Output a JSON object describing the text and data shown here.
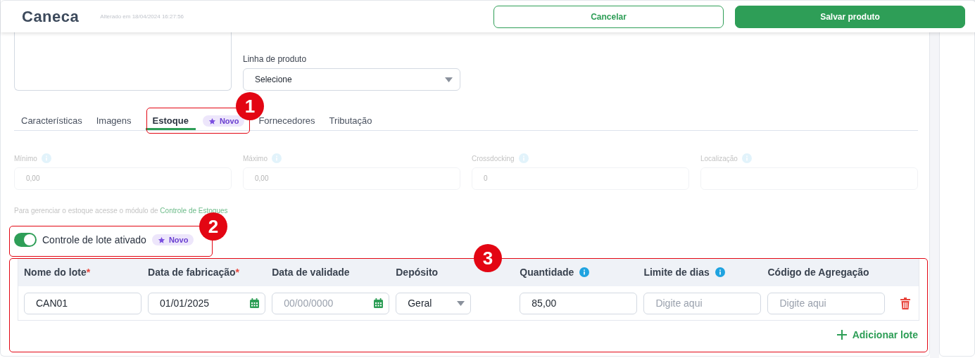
{
  "header": {
    "title": "Caneca",
    "subtitle": "Alterado em 18/04/2024 16:27:56",
    "buttons": [
      {
        "label": "Cancelar",
        "kind": "secondary"
      },
      {
        "label": "Salvar produto",
        "kind": "primary"
      }
    ]
  },
  "product_line": {
    "label": "Linha de produto",
    "value": "Selecione"
  },
  "tabs": [
    {
      "label": "Características",
      "selected": false
    },
    {
      "label": "Imagens",
      "selected": false
    },
    {
      "label": "Estoque",
      "selected": true,
      "badge": "Novo"
    },
    {
      "label": "Fornecedores",
      "selected": false
    },
    {
      "label": "Tributação",
      "selected": false
    }
  ],
  "stock_fields": [
    {
      "label": "Mínimo",
      "value": "0,00"
    },
    {
      "label": "Máximo",
      "value": "0,00"
    },
    {
      "label": "Crossdocking",
      "value": "0"
    },
    {
      "label": "Localização"
    }
  ],
  "stock_hint": {
    "text": "Para gerenciar o estoque acesse o módulo de",
    "link": "Controle de Estoques"
  },
  "batch_control": {
    "label": "Controle de lote ativado",
    "on": true,
    "badge": "Novo"
  },
  "batch_table": {
    "columns": [
      {
        "label": "Nome do lote",
        "required_mark": "*"
      },
      {
        "label": "Data de fabricação",
        "required_mark": "*"
      },
      {
        "label": "Data de validade"
      },
      {
        "label": "Depósito"
      },
      {
        "label": "Quantidade",
        "info": true
      },
      {
        "label": "Limite de dias",
        "info": true
      },
      {
        "label": "Código de Agregação"
      }
    ],
    "rows": [
      {
        "cells": [
          {
            "kind": "text",
            "value": "CAN01"
          },
          {
            "kind": "date",
            "value": "01/01/2025"
          },
          {
            "kind": "date",
            "placeholder": "00/00/0000"
          },
          {
            "kind": "select",
            "value": "Geral"
          },
          {
            "kind": "text",
            "value": "85,00"
          },
          {
            "kind": "text",
            "placeholder": "Digite aqui"
          },
          {
            "kind": "text",
            "placeholder": "Digite aqui"
          }
        ]
      }
    ],
    "add_label": "Adicionar lote"
  },
  "callouts": [
    {
      "number": "1"
    },
    {
      "number": "2"
    },
    {
      "number": "3"
    }
  ]
}
